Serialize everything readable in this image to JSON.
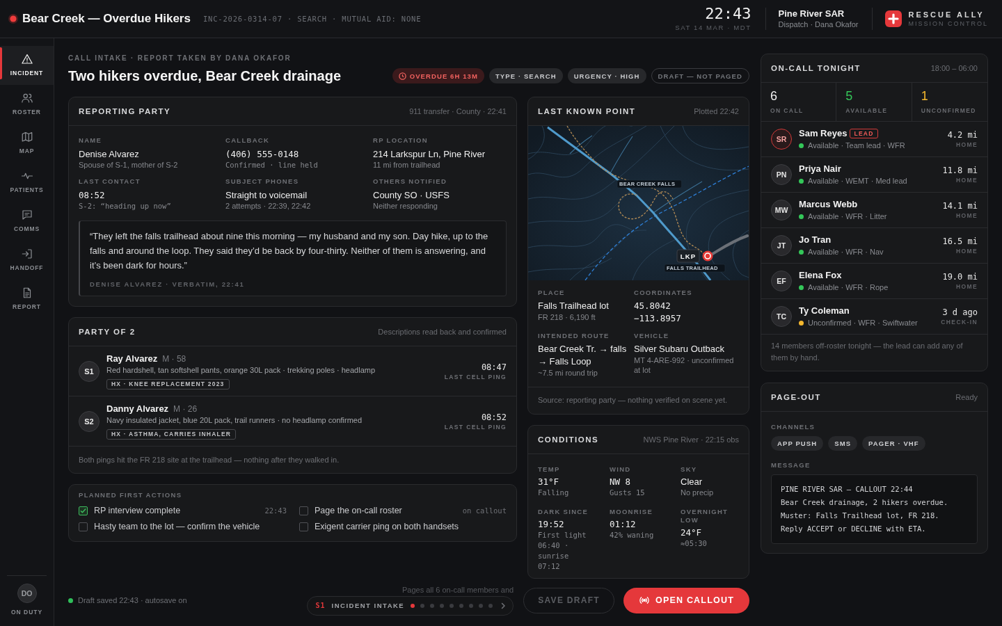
{
  "top_bar": {
    "title": "Bear Creek — Overdue Hikers",
    "meta": "INC-2026-0314-07 · SEARCH · MUTUAL AID: NONE",
    "clock": "22:43",
    "date": "SAT 14 MAR · MDT",
    "org": "Pine River SAR",
    "dispatcher": "Dispatch · Dana Okafor",
    "brand": "RESCUE ALLY",
    "tagline": "MISSION CONTROL"
  },
  "sidebar": {
    "items": [
      {
        "label": "INCIDENT",
        "selected": true
      },
      {
        "label": "ROSTER",
        "selected": false
      },
      {
        "label": "MAP",
        "selected": false
      },
      {
        "label": "PATIENTS",
        "selected": false
      },
      {
        "label": "COMMS",
        "selected": false
      },
      {
        "label": "HANDOFF",
        "selected": false
      },
      {
        "label": "REPORT",
        "selected": false
      }
    ],
    "user": {
      "initials": "DO",
      "status": "ON DUTY"
    }
  },
  "header": {
    "eyebrow": "CALL INTAKE · REPORT TAKEN BY DANA OKAFOR",
    "title": "Two hikers overdue, Bear Creek drainage",
    "chips": [
      {
        "label": "OVERDUE 6H 13M",
        "kind": "alert"
      },
      {
        "label": "TYPE · SEARCH",
        "kind": "plain"
      },
      {
        "label": "URGENCY · HIGH",
        "kind": "plain"
      },
      {
        "label": "DRAFT — NOT PAGED",
        "kind": "outline"
      }
    ]
  },
  "reporting_party": {
    "title": "REPORTING PARTY",
    "meta": "911 transfer · County · 22:41",
    "fields": [
      {
        "label": "NAME",
        "value": "Denise Alvarez",
        "note": "Spouse of S-1, mother of S-2",
        "kind": "text"
      },
      {
        "label": "CALLBACK",
        "value": "(406) 555-0148",
        "note": "Confirmed · line held",
        "kind": "mono"
      },
      {
        "label": "RP LOCATION",
        "value": "214 Larkspur Ln, Pine River",
        "note": "11 mi from trailhead",
        "kind": "text"
      },
      {
        "label": "LAST CONTACT",
        "value": "08:52",
        "note": "S-2: “heading up now”",
        "kind": "mono"
      },
      {
        "label": "SUBJECT PHONES",
        "value": "Straight to voicemail",
        "note": "2 attempts · 22:39, 22:42",
        "kind": "text"
      },
      {
        "label": "OTHERS NOTIFIED",
        "value": "County SO · USFS",
        "note": "Neither responding",
        "kind": "text"
      }
    ],
    "quote": {
      "text": "“They left the falls trailhead about nine this morning — my husband and my son. Day hike, up to the falls and around the loop. They said they’d be back by four-thirty. Neither of them is answering, and it’s been dark for hours.”",
      "attribution": "DENISE ALVAREZ · VERBATIM, 22:41"
    }
  },
  "party": {
    "title": "PARTY OF 2",
    "meta": "Descriptions read back and confirmed",
    "subjects": [
      {
        "tag": "S1",
        "name": "Ray Alvarez",
        "info": "M · 58",
        "description": "Red hardshell, tan softshell pants, orange 30L pack · trekking poles · headlamp",
        "history": "HX · KNEE REPLACEMENT 2023",
        "time": "08:47",
        "time_label": "LAST CELL PING"
      },
      {
        "tag": "S2",
        "name": "Danny Alvarez",
        "info": "M · 26",
        "description": "Navy insulated jacket, blue 20L pack, trail runners · no headlamp confirmed",
        "history": "HX · ASTHMA, CARRIES INHALER",
        "time": "08:52",
        "time_label": "LAST CELL PING"
      }
    ],
    "note": "Both pings hit the FR 218 site at the trailhead — nothing after they walked in."
  },
  "actions": {
    "title": "PLANNED FIRST ACTIONS",
    "items": [
      {
        "label": "RP interview complete",
        "meta": "22:43",
        "checked": true
      },
      {
        "label": "Page the on-call roster",
        "meta": "on callout",
        "checked": false
      },
      {
        "label": "Hasty team to the lot — confirm the vehicle",
        "checked": false
      },
      {
        "label": "Exigent carrier ping on both handsets",
        "checked": false
      }
    ]
  },
  "last_known_point": {
    "title": "LAST KNOWN POINT",
    "meta": "Plotted 22:42",
    "map": {
      "marker_label": "LKP",
      "labels": [
        "BEAR CREEK FALLS",
        "FALLS TRAILHEAD"
      ]
    },
    "fields": [
      {
        "label": "PLACE",
        "value": "Falls Trailhead lot",
        "note": "FR 218 · 6,190 ft",
        "kind": "text"
      },
      {
        "label": "COORDINATES",
        "value": "45.8042\n−113.8957",
        "kind": "mono"
      },
      {
        "label": "INTENDED ROUTE",
        "value": "Bear Creek Tr. → falls → Falls Loop",
        "note": "~7.5 mi round trip",
        "kind": "text"
      },
      {
        "label": "VEHICLE",
        "value": "Silver Subaru Outback",
        "note": "MT 4-ARE-992 · unconfirmed at lot",
        "kind": "text"
      }
    ],
    "source": "Source: reporting party — nothing verified on scene yet."
  },
  "conditions": {
    "title": "CONDITIONS",
    "meta": "NWS Pine River · 22:15 obs",
    "fields": [
      {
        "label": "TEMP",
        "value": "31°F",
        "note": "Falling",
        "kind": "mono"
      },
      {
        "label": "WIND",
        "value": "NW 8",
        "note": "Gusts 15",
        "kind": "mono"
      },
      {
        "label": "SKY",
        "value": "Clear",
        "note": "No precip",
        "kind": "text"
      },
      {
        "label": "DARK SINCE",
        "value": "19:52",
        "note": "First light 06:40 · sunrise 07:12",
        "kind": "mono"
      },
      {
        "label": "MOONRISE",
        "value": "01:12",
        "note": "42% waning",
        "kind": "mono"
      },
      {
        "label": "OVERNIGHT LOW",
        "value": "24°F",
        "note": "≈05:30",
        "kind": "mono"
      }
    ]
  },
  "on_call": {
    "title": "ON-CALL TONIGHT",
    "meta": "18:00 – 06:00",
    "stats": [
      {
        "value": "6",
        "label": "ON CALL",
        "color": "#f2f2f2"
      },
      {
        "value": "5",
        "label": "AVAILABLE",
        "color": "#34c759"
      },
      {
        "value": "1",
        "label": "UNCONFIRMED",
        "color": "#f5b82e"
      }
    ],
    "members": [
      {
        "initials": "SR",
        "name": "Sam Reyes",
        "lead": true,
        "badge": "LEAD",
        "status": "Available · Team lead · WFR",
        "color": "#34c759",
        "distance": "4.2 mi",
        "distance_label": "HOME"
      },
      {
        "initials": "PN",
        "name": "Priya Nair",
        "lead": false,
        "status": "Available · WEMT · Med lead",
        "color": "#34c759",
        "distance": "11.8 mi",
        "distance_label": "HOME"
      },
      {
        "initials": "MW",
        "name": "Marcus Webb",
        "lead": false,
        "status": "Available · WFR · Litter",
        "color": "#34c759",
        "distance": "14.1 mi",
        "distance_label": "HOME"
      },
      {
        "initials": "JT",
        "name": "Jo Tran",
        "lead": false,
        "status": "Available · WFR · Nav",
        "color": "#34c759",
        "distance": "16.5 mi",
        "distance_label": "HOME"
      },
      {
        "initials": "EF",
        "name": "Elena Fox",
        "lead": false,
        "status": "Available · WFR · Rope",
        "color": "#34c759",
        "distance": "19.0 mi",
        "distance_label": "HOME"
      },
      {
        "initials": "TC",
        "name": "Ty Coleman",
        "lead": false,
        "status": "Unconfirmed · WFR · Swiftwater",
        "color": "#f5b82e",
        "distance": "3 d ago",
        "distance_label": "CHECK-IN"
      }
    ],
    "note": "14 members off-roster tonight — the lead can add any of them by hand."
  },
  "page_out": {
    "title": "PAGE-OUT",
    "meta": "Ready",
    "channels_label": "CHANNELS",
    "channels": [
      "APP PUSH",
      "SMS",
      "PAGER · VHF"
    ],
    "message_label": "MESSAGE",
    "message": "PINE RIVER SAR — CALLOUT 22:44\nBear Creek drainage, 2 hikers overdue.\nMuster: Falls Trailhead lot, FR 218.\nReply ACCEPT or DECLINE with ETA."
  },
  "bottom_bar": {
    "status": "Draft saved 22:43 · autosave on",
    "hint": "Pages all 6 on-call members and",
    "stepper": {
      "code": "S1",
      "label": "INCIDENT INTAKE",
      "steps": [
        {
          "selected": true
        },
        {
          "selected": false
        },
        {
          "selected": false
        },
        {
          "selected": false
        },
        {
          "selected": false
        },
        {
          "selected": false
        },
        {
          "selected": false
        },
        {
          "selected": false
        },
        {
          "selected": false
        }
      ]
    },
    "save_button": {
      "label": "SAVE DRAFT",
      "disabled": true
    },
    "primary_button": {
      "label": "OPEN CALLOUT"
    }
  }
}
